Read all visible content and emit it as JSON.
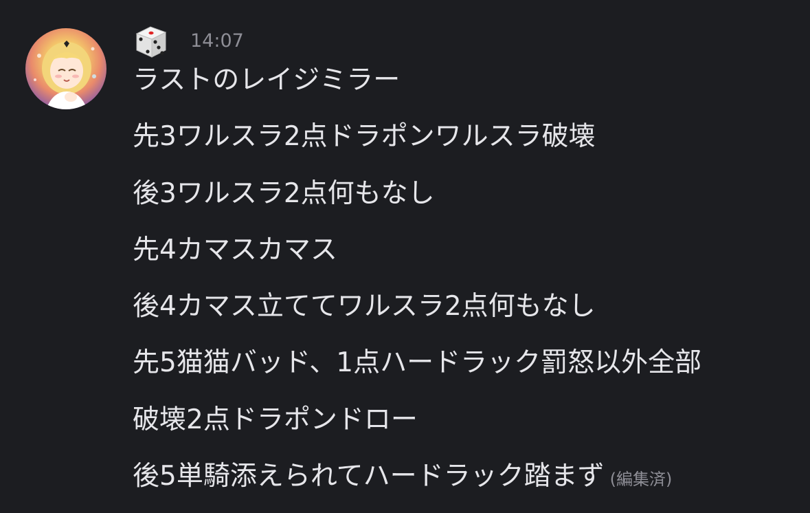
{
  "message": {
    "timestamp": "14:07",
    "avatar_icon": "anime-girl-avatar",
    "sender_icon": "dice-icon",
    "lines": [
      "ラストのレイジミラー",
      "先3ワルスラ2点ドラポンワルスラ破壊",
      "後3ワルスラ2点何もなし",
      "先4カマスカマス",
      "後4カマス立ててワルスラ2点何もなし",
      "先5猫猫バッド、1点ハードラック罰怒以外全部",
      "破壊2点ドラポンドロー",
      "後5単騎添えられてハードラック踏まず"
    ],
    "edited_label": "(編集済)"
  }
}
